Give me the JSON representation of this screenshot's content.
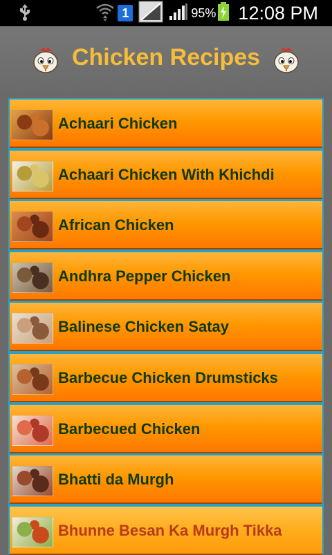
{
  "status_bar": {
    "sim_slot": "1",
    "battery_percent": "95%",
    "time": "12:08 PM"
  },
  "header": {
    "title": "Chicken Recipes"
  },
  "recipes": [
    {
      "label": "Achaari Chicken",
      "thumb_colors": [
        "#c9702a",
        "#8a3b14",
        "#e2a04a"
      ]
    },
    {
      "label": "Achaari Chicken With Khichdi",
      "thumb_colors": [
        "#d9c46a",
        "#b79d3a",
        "#f2f0e6"
      ]
    },
    {
      "label": "African Chicken",
      "thumb_colors": [
        "#6a2a12",
        "#a1461f",
        "#d78a4a"
      ]
    },
    {
      "label": "Andhra Pepper Chicken",
      "thumb_colors": [
        "#4a3020",
        "#7b5a3a",
        "#c9c2b4"
      ]
    },
    {
      "label": "Balinese Chicken Satay",
      "thumb_colors": [
        "#8a5a3a",
        "#c9a07a",
        "#e8e0d4"
      ]
    },
    {
      "label": "Barbecue Chicken Drumsticks",
      "thumb_colors": [
        "#7a3a1a",
        "#b5622e",
        "#d9c0a0"
      ]
    },
    {
      "label": "Barbecued Chicken",
      "thumb_colors": [
        "#b03a2a",
        "#e06a4a",
        "#f2e0d4"
      ]
    },
    {
      "label": "Bhatti da Murgh",
      "thumb_colors": [
        "#5a2a1a",
        "#9a4a2a",
        "#e0d8d0"
      ]
    },
    {
      "label": "Bhunne Besan Ka Murgh Tikka",
      "thumb_colors": [
        "#c94a1a",
        "#8ab04a",
        "#f4ecdc"
      ]
    }
  ]
}
